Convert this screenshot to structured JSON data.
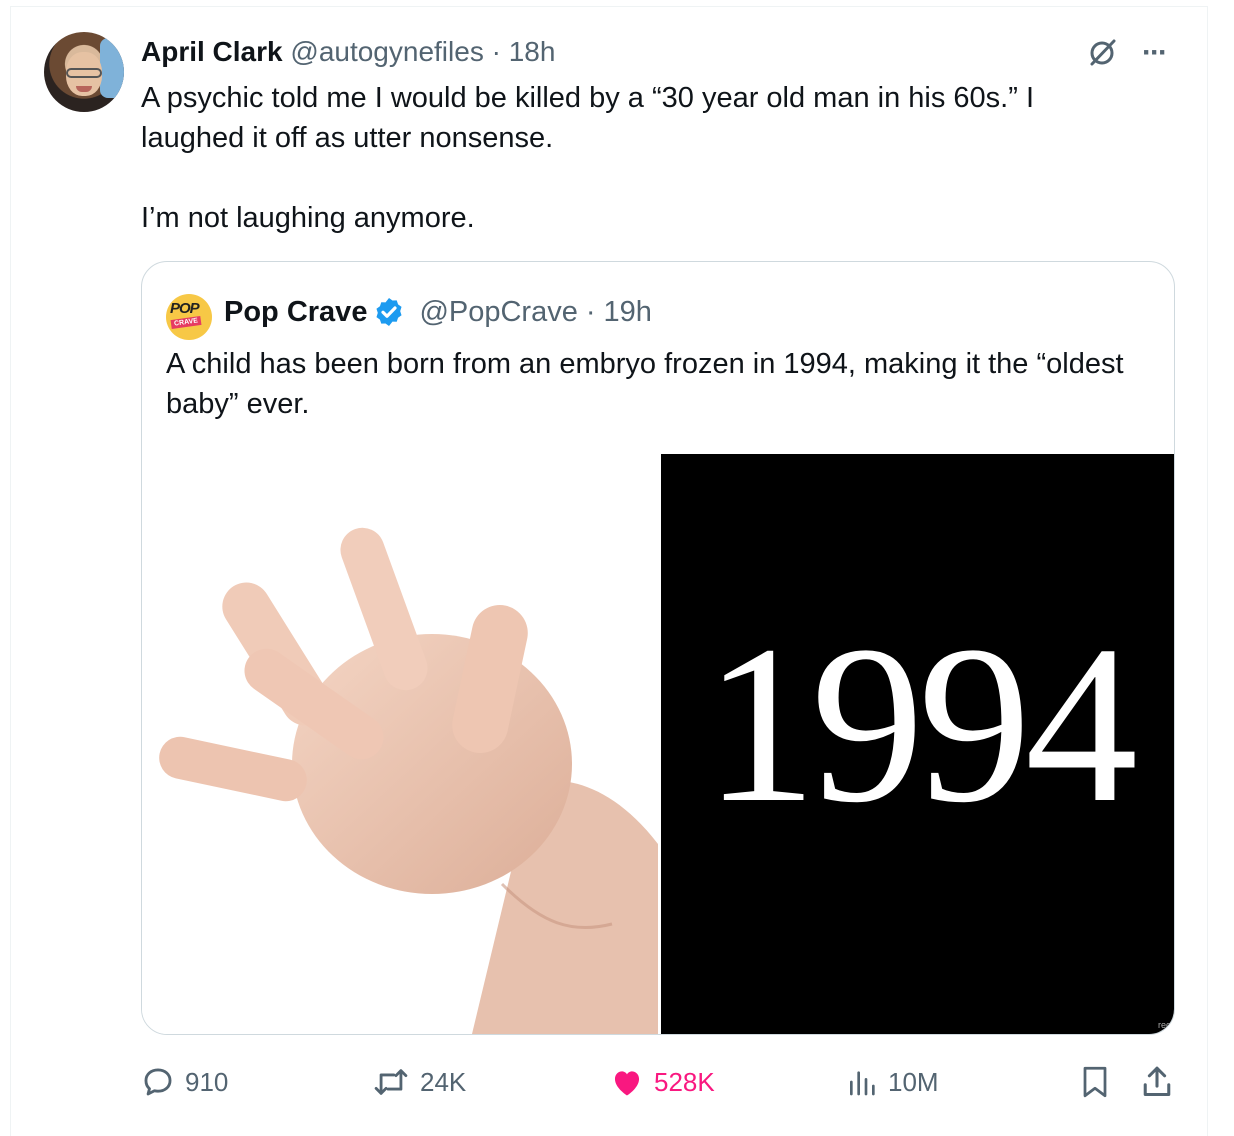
{
  "tweet": {
    "author_name": "April Clark",
    "author_handle": "@autogynefiles",
    "separator": "·",
    "time": "18h",
    "text": "A psychic told me I would be killed by a “30 year old man in his 60s.” I laughed it off as utter nonsense.\n\nI’m not laughing anymore.",
    "more_label": "···"
  },
  "quote": {
    "author_name": "Pop Crave",
    "author_handle": "@PopCrave",
    "separator": "·",
    "time": "19h",
    "logo_top": "POP",
    "logo_bottom": "CRAVE",
    "text": "A child has been born from an embryo frozen in 1994, making it the “oldest baby” ever.",
    "media_year": "1994",
    "media_watermark": "rect"
  },
  "actions": {
    "replies": "910",
    "reposts": "24K",
    "likes": "528K",
    "views": "10M"
  },
  "colors": {
    "accent": "#1d9bf0",
    "like": "#f91880",
    "muted": "#536471",
    "border": "#cfd9de"
  },
  "icons": [
    "grok-icon",
    "more-icon",
    "verified-icon",
    "reply-icon",
    "repost-icon",
    "heart-icon",
    "views-icon",
    "bookmark-icon",
    "share-icon"
  ]
}
